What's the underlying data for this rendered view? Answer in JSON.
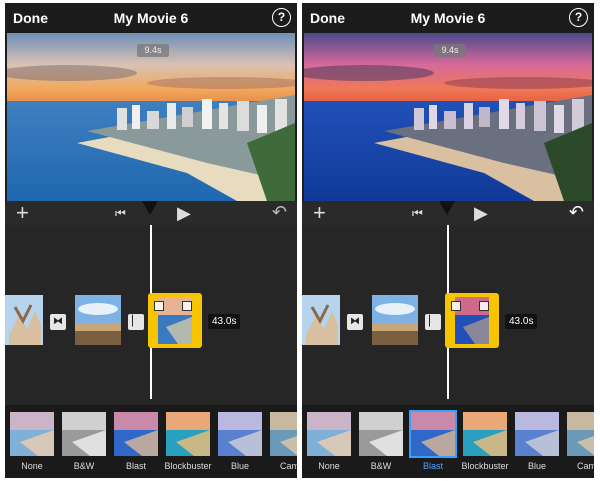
{
  "panels": [
    {
      "topbar": {
        "done_label": "Done",
        "title": "My Movie 6",
        "help_label": "?"
      },
      "viewer": {
        "duration": "9.4s",
        "filter_applied": "None"
      },
      "timeline": {
        "clip_duration": "43.0s"
      },
      "filters": {
        "items": [
          "None",
          "B&W",
          "Blast",
          "Blockbuster",
          "Blue",
          "Came"
        ],
        "selected": "None"
      }
    },
    {
      "topbar": {
        "done_label": "Done",
        "title": "My Movie 6",
        "help_label": "?"
      },
      "viewer": {
        "duration": "9.4s",
        "filter_applied": "Blast"
      },
      "timeline": {
        "clip_duration": "43.0s"
      },
      "filters": {
        "items": [
          "None",
          "B&W",
          "Blast",
          "Blockbuster",
          "Blue",
          "Came"
        ],
        "selected": "Blast"
      }
    }
  ],
  "colors": {
    "accent_selection": "#f7c500",
    "accent_filter": "#3aa0ff"
  },
  "icons": [
    "plus-icon",
    "skip-back-icon",
    "play-icon",
    "undo-icon",
    "help-icon",
    "transition-icon"
  ]
}
